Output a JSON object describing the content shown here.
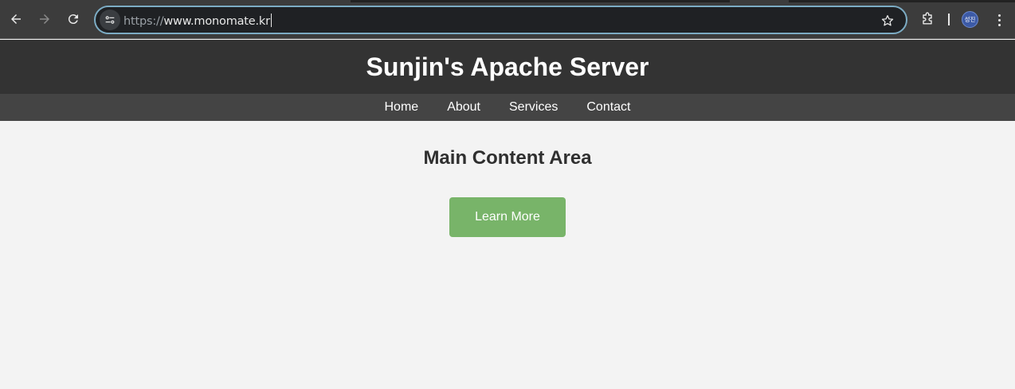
{
  "browser": {
    "url_scheme": "https://",
    "url_host": "www.monomate.kr",
    "profile_initials": "성진",
    "icons": {
      "back": "arrow-left-icon",
      "forward": "arrow-right-icon",
      "reload": "reload-icon",
      "site_info": "tune-icon",
      "bookmark": "star-outline-icon",
      "extensions": "puzzle-icon",
      "menu": "kebab-menu-icon"
    }
  },
  "page": {
    "title": "Sunjin's Apache Server",
    "nav": [
      {
        "label": "Home"
      },
      {
        "label": "About"
      },
      {
        "label": "Services"
      },
      {
        "label": "Contact"
      }
    ],
    "main_heading": "Main Content Area",
    "cta_label": "Learn More"
  },
  "colors": {
    "header_bg": "#333333",
    "nav_bg": "#444444",
    "content_bg": "#f3f3f3",
    "cta_bg": "#78b469",
    "omnibox_focus_ring": "#7cacc4"
  }
}
